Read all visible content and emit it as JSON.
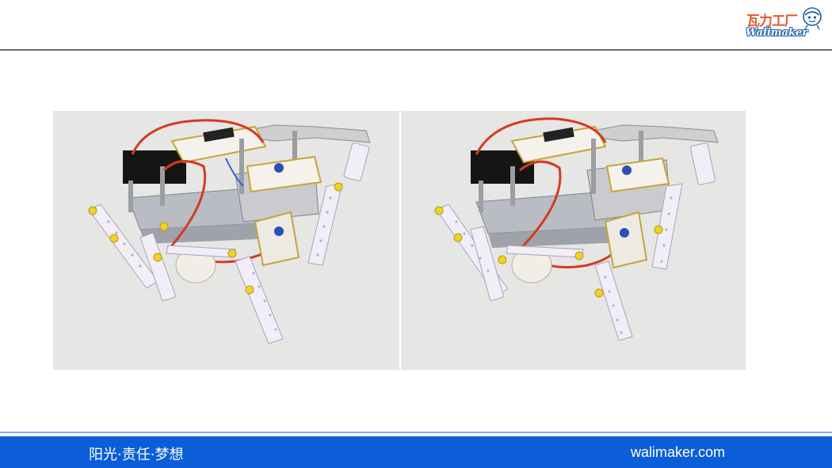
{
  "header": {
    "logo": {
      "cn_text": "瓦力工厂",
      "en_text": "Walimaker"
    }
  },
  "main": {
    "photos": [
      {
        "name": "robot-photo-left"
      },
      {
        "name": "robot-photo-right"
      }
    ]
  },
  "footer": {
    "slogan": "阳光·责任·梦想",
    "website": "walimaker.com"
  },
  "colors": {
    "footer_background": "#0b5ed8",
    "header_rule": "#6b6b6b",
    "logo_orange": "#e8582a",
    "logo_blue": "#1b5fa8"
  }
}
